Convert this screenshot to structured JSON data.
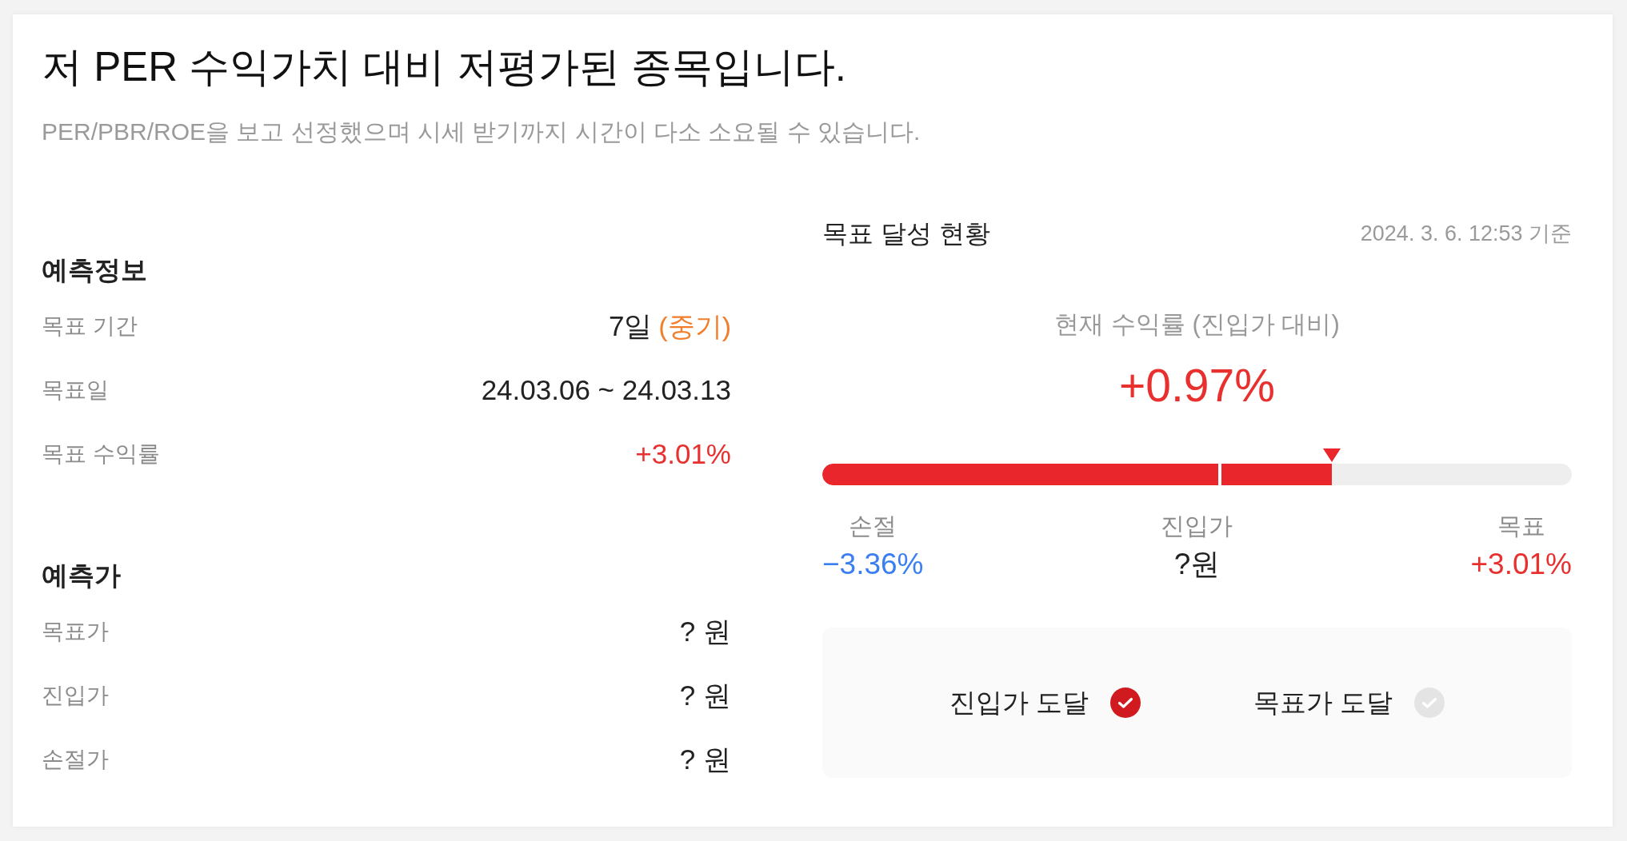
{
  "title": "저 PER 수익가치 대비 저평가된 종목입니다.",
  "subtitle": "PER/PBR/ROE을 보고 선정했으며 시세 받기까지 시간이 다소 소요될 수 있습니다.",
  "forecast": {
    "sections": [
      {
        "heading": "예측정보",
        "rows": [
          {
            "label": "목표 기간",
            "value": "7일",
            "note": "(중기)",
            "color": "#222222"
          },
          {
            "label": "목표일",
            "value": "24.03.06 ~ 24.03.13",
            "color": "#222222"
          },
          {
            "label": "목표 수익률",
            "value": "+3.01%",
            "color": "#e8312f"
          }
        ]
      },
      {
        "heading": "예측가",
        "rows": [
          {
            "label": "목표가",
            "value": "? 원",
            "color": "#222222"
          },
          {
            "label": "진입가",
            "value": "? 원",
            "color": "#222222"
          },
          {
            "label": "손절가",
            "value": "? 원",
            "color": "#222222"
          }
        ]
      }
    ]
  },
  "achievement": {
    "heading": "목표 달성 현황",
    "timestamp": "2024. 3. 6. 12:53 기준",
    "current_return": {
      "label": "현재 수익률 (진입가 대비)",
      "value": "+0.97%"
    },
    "bar": {
      "level": 0.68,
      "entry_marker": {
        "level": 0.53
      }
    },
    "scale": [
      {
        "label": "손절",
        "value": "−3.36%",
        "color": "#3a7ff2"
      },
      {
        "label": "진입가",
        "value": "?원",
        "color": "#222222"
      },
      {
        "label": "목표",
        "value": "+3.01%",
        "color": "#e8312f"
      }
    ],
    "milestones": [
      {
        "label": "진입가 도달",
        "checked": true
      },
      {
        "label": "목표가 도달",
        "checked": false
      }
    ]
  }
}
